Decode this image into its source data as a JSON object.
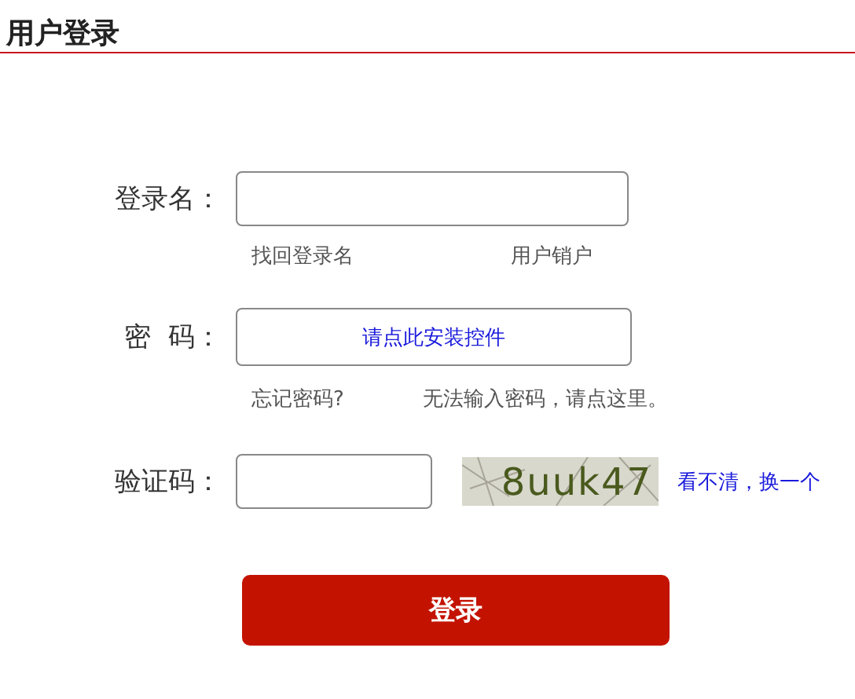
{
  "title": "用户登录",
  "username": {
    "label": "登录名：",
    "links": [
      "找回登录名",
      "用户销户"
    ]
  },
  "password": {
    "label": "密  码：",
    "install_link": "请点此安装控件",
    "links": [
      "忘记密码?",
      "无法输入密码，请点这里。"
    ]
  },
  "captcha": {
    "label": "验证码：",
    "code": "8uuk47",
    "refresh_link": "看不清，换一个"
  },
  "submit": "登录"
}
